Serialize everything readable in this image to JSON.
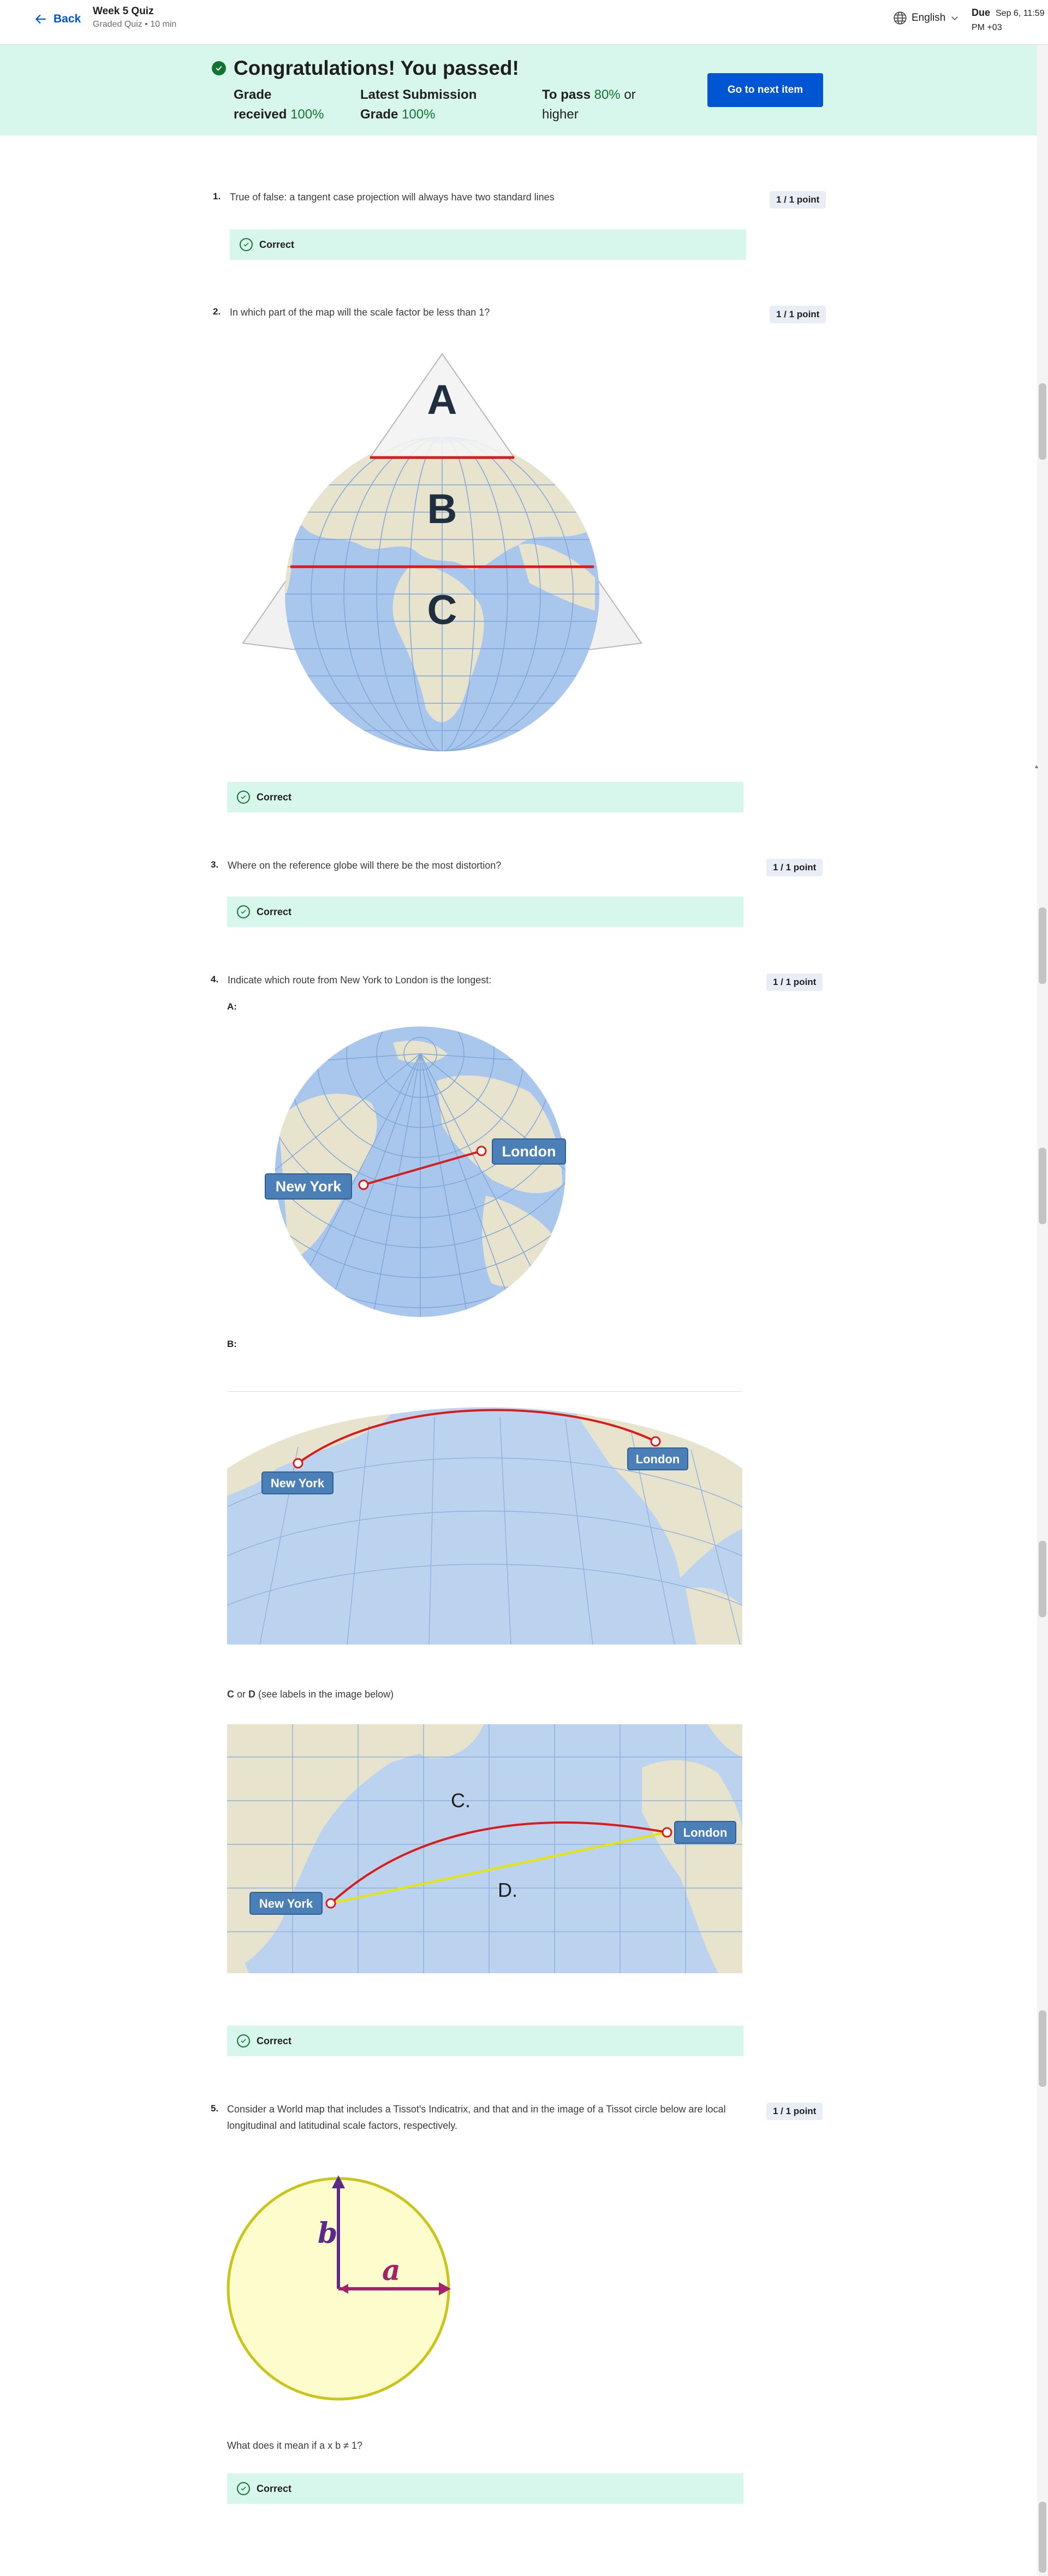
{
  "header": {
    "back_label": "Back",
    "quiz_title": "Week 5 Quiz",
    "quiz_subtitle": "Graded Quiz • 10 min",
    "language": "English",
    "due_label": "Due",
    "due_line1": "Sep 6, 11:59",
    "due_line2": "PM +03"
  },
  "banner": {
    "title": "Congratulations! You passed!",
    "grade_label_1": "Grade",
    "grade_label_2": "received",
    "grade_value": "100%",
    "latest_label": "Latest Submission",
    "latest_grade_label": "Grade",
    "latest_value": "100%",
    "pass_label": "To pass",
    "pass_value": "80%",
    "pass_suffix": "or",
    "pass_line2": "higher",
    "next_button": "Go to next item"
  },
  "correct_label": "Correct",
  "questions": [
    {
      "num": "1.",
      "text": "True of false: a tangent case projection will always have two standard lines",
      "points": "1 / 1 point"
    },
    {
      "num": "2.",
      "text": "In which part of the map will the scale factor be less than 1?",
      "points": "1 / 1 point",
      "figure_labels": [
        "A",
        "B",
        "C"
      ]
    },
    {
      "num": "3.",
      "text": "Where on the reference globe will there be the most distortion?",
      "points": "1 / 1 point"
    },
    {
      "num": "4.",
      "text": "Indicate which route from New York to London is the longest:",
      "points": "1 / 1 point",
      "option_a": "A:",
      "option_b": "B:",
      "option_cd_c": "C",
      "option_cd_or": " or ",
      "option_cd_d": "D",
      "option_cd_rest": " (see labels in the image below)",
      "city_ny": "New York",
      "city_london": "London",
      "route_c": "C.",
      "route_d": "D."
    },
    {
      "num": "5.",
      "text": "Consider a World map that includes a Tissot's Indicatrix, and that  and  in the image of a Tissot circle below are local longitudinal and latitudinal scale factors, respectively.",
      "points": "1 / 1 point",
      "label_a": "a",
      "label_b": "b",
      "followup": "What does it mean if a x b ≠ 1?"
    }
  ],
  "colors": {
    "brand": "#0056d2",
    "success": "#137333",
    "banner_bg": "#d7f6ec",
    "route_red": "#d81b1b",
    "route_yellow": "#e6e600",
    "city_label": "#4a7fb8"
  }
}
